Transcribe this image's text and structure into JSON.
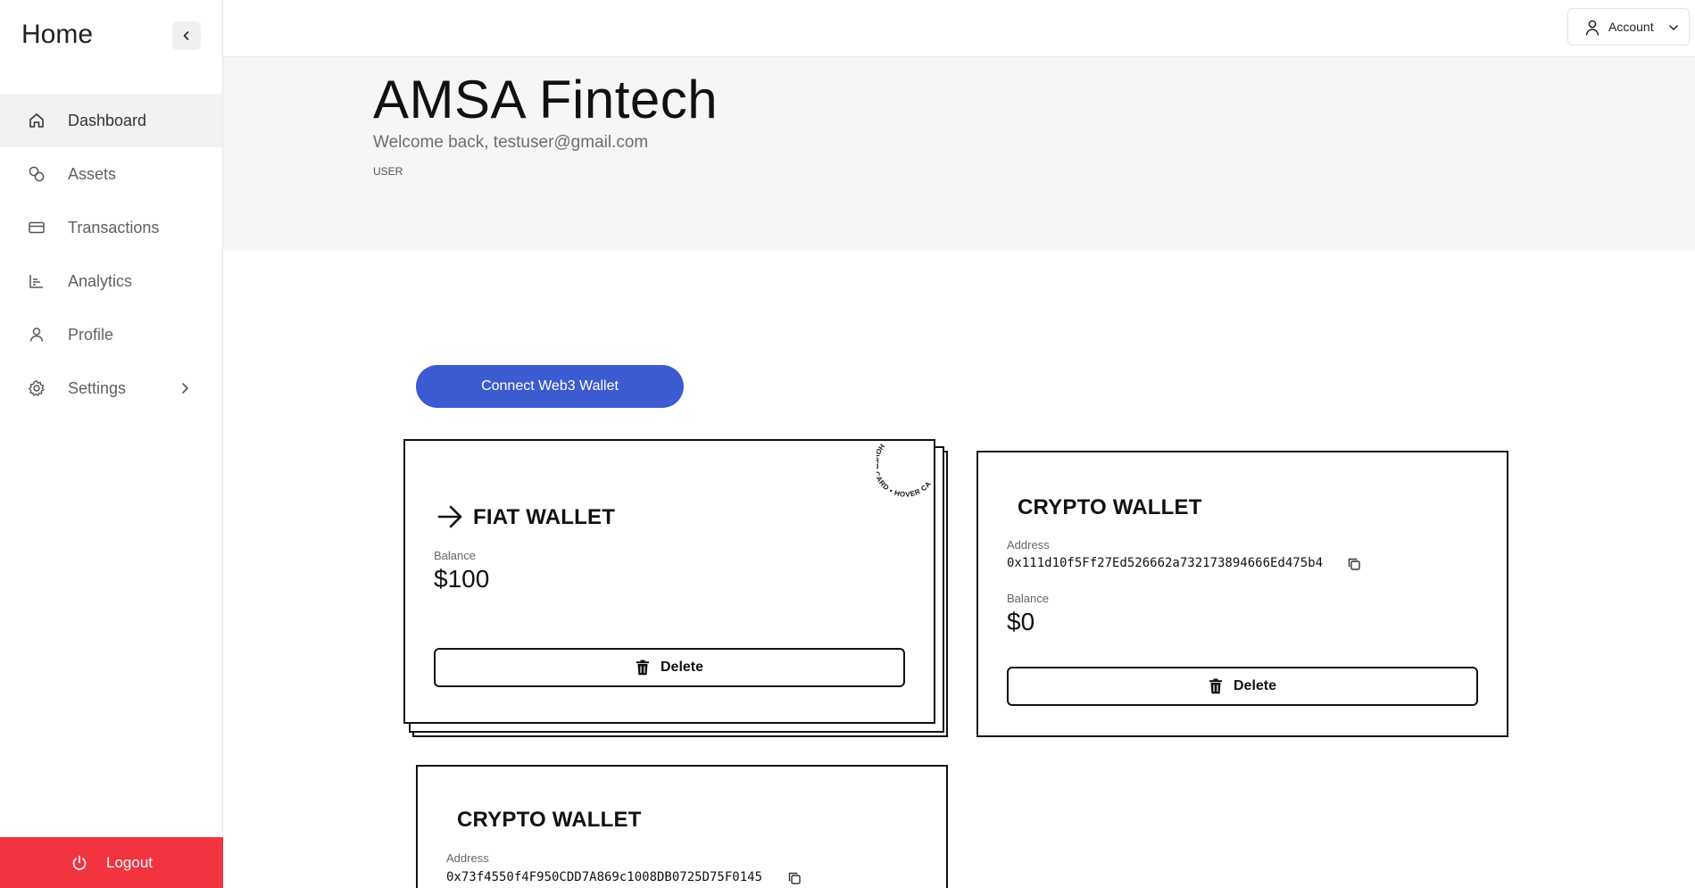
{
  "sidebar": {
    "title": "Home",
    "items": [
      {
        "label": "Dashboard",
        "icon": "home-icon"
      },
      {
        "label": "Assets",
        "icon": "coins-icon"
      },
      {
        "label": "Transactions",
        "icon": "credit-card-icon"
      },
      {
        "label": "Analytics",
        "icon": "bar-chart-icon"
      },
      {
        "label": "Profile",
        "icon": "user-icon"
      },
      {
        "label": "Settings",
        "icon": "gear-icon"
      }
    ],
    "logout_label": "Logout"
  },
  "topbar": {
    "account_label": "Account"
  },
  "header": {
    "title": "AMSA Fintech",
    "welcome": "Welcome back, testuser@gmail.com",
    "role": "USER"
  },
  "connect_button_label": "Connect Web3 Wallet",
  "wallets": [
    {
      "type": "FIAT WALLET",
      "balance_label": "Balance",
      "balance": "$100",
      "delete_label": "Delete",
      "badge_text": "HOVER CARD • HOVER CARD •"
    },
    {
      "type": "CRYPTO WALLET",
      "address_label": "Address",
      "address": "0x111d10f5Ff27Ed526662a732173894666Ed475b4",
      "balance_label": "Balance",
      "balance": "$0",
      "delete_label": "Delete"
    },
    {
      "type": "CRYPTO WALLET",
      "address_label": "Address",
      "address": "0x73f4550f4F950CDD7A869c1008DB0725D75F0145"
    }
  ],
  "colors": {
    "primary": "#3d5bd1",
    "logout": "#f23340",
    "header_band": "#f6f6f4"
  }
}
